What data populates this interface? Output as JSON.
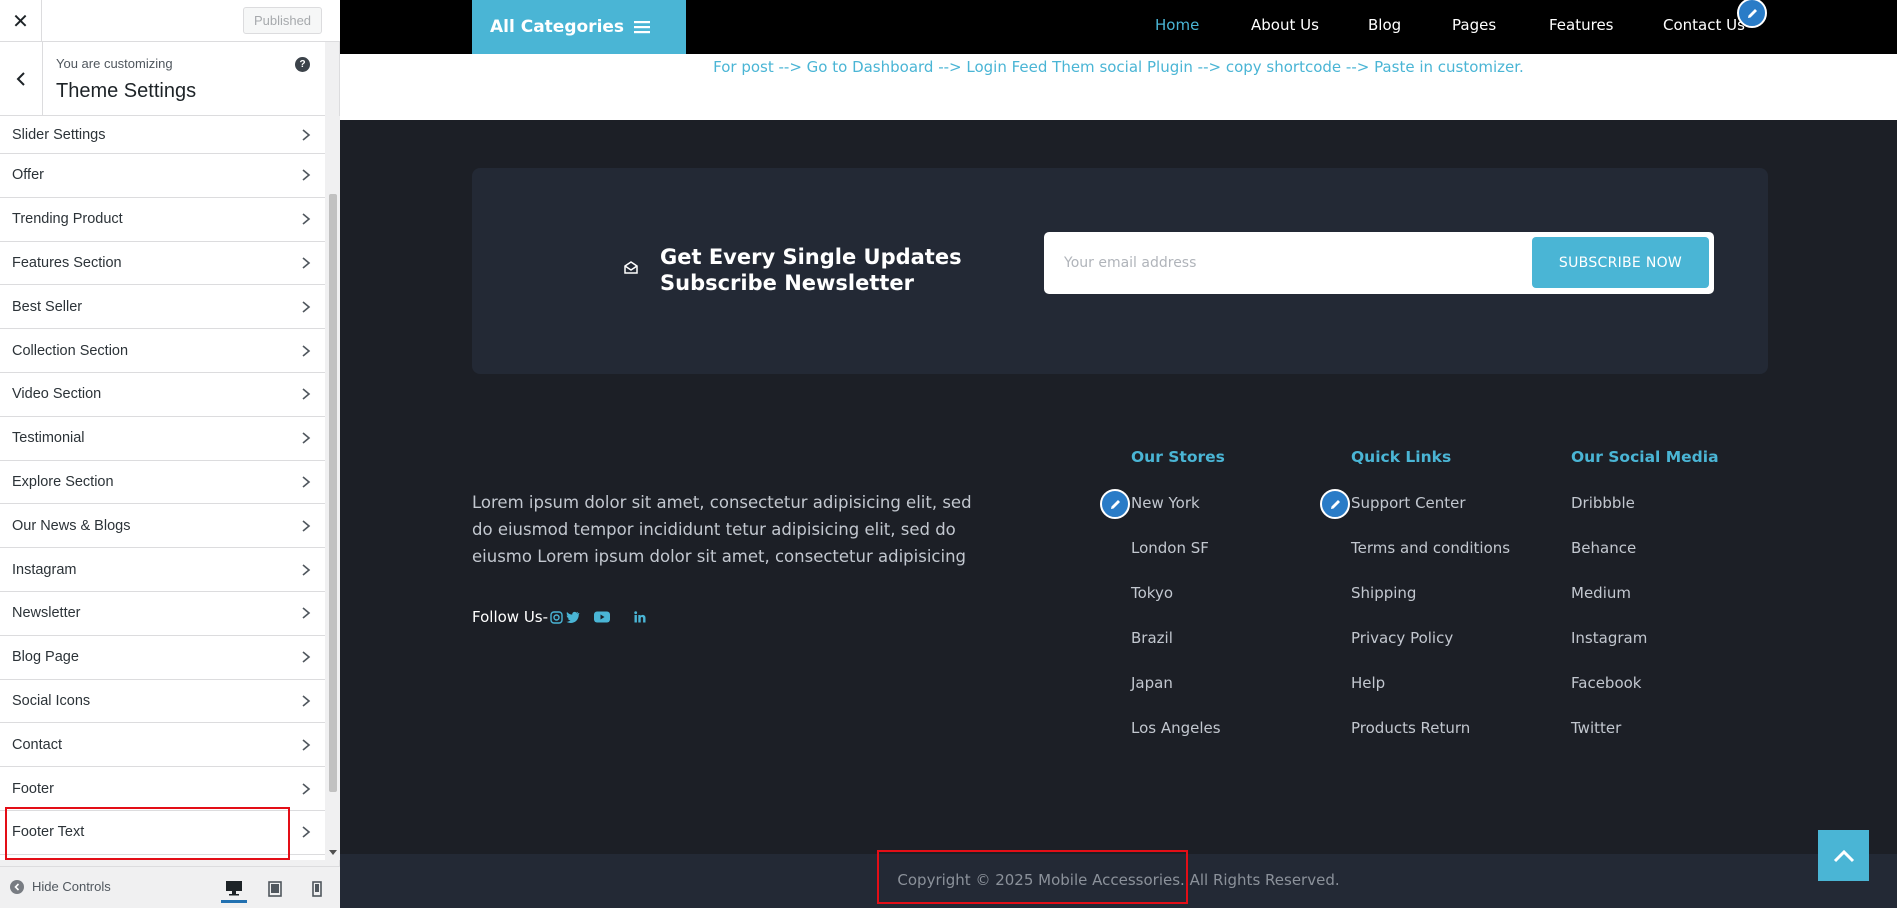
{
  "customizer": {
    "close_label": "✕",
    "published_label": "Published",
    "customizing_label": "You are customizing",
    "section_title": "Theme Settings",
    "help_label": "?",
    "panels": [
      "Slider Settings",
      "Offer",
      "Trending Product",
      "Features Section",
      "Best Seller",
      "Collection Section",
      "Video Section",
      "Testimonial",
      "Explore Section",
      "Our News & Blogs",
      "Instagram",
      "Newsletter",
      "Blog Page",
      "Social Icons",
      "Contact",
      "Footer",
      "Footer Text"
    ],
    "hide_controls_label": "Hide Controls",
    "devices": [
      "desktop-icon",
      "tablet-icon",
      "mobile-icon"
    ],
    "highlight_color": "#e30e17"
  },
  "preview": {
    "all_categories": "All Categories",
    "nav": [
      "Home",
      "About Us",
      "Blog",
      "Pages",
      "Features",
      "Contact Us"
    ],
    "nav_active": "Home",
    "shortcode_note": "For post --> Go to Dashboard --> Login Feed Them social Plugin --> copy shortcode --> Paste in customizer.",
    "newsletter": {
      "heading_line1": "Get Every Single Updates",
      "heading_line2": "Subscribe Newsletter",
      "email_placeholder": "Your email address",
      "button_label": "SUBSCRIBE NOW"
    },
    "about_text": "Lorem ipsum dolor sit amet, consectetur adipisicing elit, sed do eiusmod tempor incididunt tetur adipisicing elit, sed do eiusmo Lorem ipsum dolor sit amet, consectetur adipisicing",
    "follow_us_label": "Follow Us-",
    "social_icons": [
      "instagram-icon",
      "twitter-icon",
      "youtube-icon",
      "linkedin-icon"
    ],
    "columns": [
      {
        "title": "Our Stores",
        "links": [
          "New York",
          "London SF",
          "Tokyo",
          "Brazil",
          "Japan",
          "Los Angeles"
        ]
      },
      {
        "title": "Quick Links",
        "links": [
          "Support Center",
          "Terms and conditions",
          "Shipping",
          "Privacy Policy",
          "Help",
          "Products Return"
        ]
      },
      {
        "title": "Our Social Media",
        "links": [
          "Dribbble",
          "Behance",
          "Medium",
          "Instagram",
          "Facebook",
          "Twitter"
        ]
      }
    ],
    "copyright": "Copyright © 2025 Mobile Accessories. All Rights Reserved.",
    "accent_color": "#4ab5d5"
  }
}
